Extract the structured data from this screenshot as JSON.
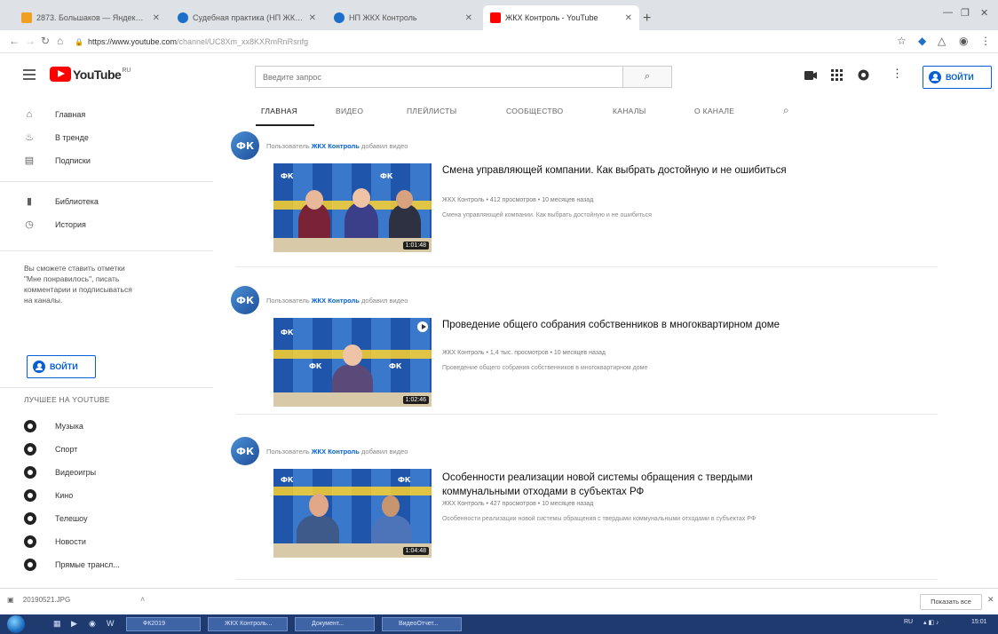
{
  "browser": {
    "tabs": [
      {
        "title": "2873. Большаков — Яндекс.Ди..",
        "favicon_color": "#f0a020",
        "active": false
      },
      {
        "title": "Судебная практика (НП ЖКХ ...",
        "favicon_color": "#1d6fc8",
        "active": false
      },
      {
        "title": "НП ЖКХ Контроль",
        "favicon_color": "#1d6fc8",
        "active": false
      },
      {
        "title": "ЖКХ Контроль - YouTube",
        "favicon_color": "#ff0000",
        "active": true
      }
    ],
    "new_tab_label": "+",
    "url_host": "https://www.youtube.com",
    "url_path": "/channel/UC8Xm_xx8KXRmRnRsnfg",
    "lock_icon": "lock-icon"
  },
  "masthead": {
    "logo_text": "YouTube",
    "logo_country": "RU",
    "search_placeholder": "Введите запрос",
    "signin_label": "ВОЙТИ"
  },
  "sidebar": {
    "nav": [
      {
        "label": "Главная",
        "icon": "home-icon"
      },
      {
        "label": "В тренде",
        "icon": "fire-icon"
      },
      {
        "label": "Подписки",
        "icon": "subscriptions-icon"
      }
    ],
    "library": [
      {
        "label": "Библиотека",
        "icon": "library-icon"
      },
      {
        "label": "История",
        "icon": "history-icon"
      }
    ],
    "signin_note": "Вы сможете ставить отметки \"Мне понравилось\", писать комментарии и подписываться на каналы.",
    "signin_label": "ВОЙТИ",
    "best_heading": "ЛУЧШЕЕ НА YOUTUBE",
    "best": [
      {
        "label": "Музыка",
        "icon": "music-icon"
      },
      {
        "label": "Спорт",
        "icon": "sport-icon"
      },
      {
        "label": "Видеоигры",
        "icon": "gaming-icon"
      },
      {
        "label": "Кино",
        "icon": "movies-icon"
      },
      {
        "label": "Телешоу",
        "icon": "tv-icon"
      },
      {
        "label": "Новости",
        "icon": "news-icon"
      },
      {
        "label": "Прямые трансл...",
        "icon": "live-icon"
      }
    ]
  },
  "channel_tabs": [
    "ГЛАВНАЯ",
    "ВИДЕО",
    "ПЛЕЙЛИСТЫ",
    "СООБЩЕСТВО",
    "КАНАЛЫ",
    "О КАНАЛЕ"
  ],
  "feed": [
    {
      "activity_prefix": "Пользователь",
      "channel": "ЖКХ Контроль",
      "activity_suffix": "добавил видео",
      "title": "Смена управляющей компании. Как выбрать достойную и не ошибиться",
      "meta": "ЖКХ Контроль • 412 просмотров • 10 месяцев назад",
      "description": "Смена управляющей компании. Как выбрать достойную и не ошибиться",
      "duration": "1:01:48"
    },
    {
      "activity_prefix": "Пользователь",
      "channel": "ЖКХ Контроль",
      "activity_suffix": "добавил видео",
      "title": "Проведение общего собрания собственников в многоквартирном доме",
      "meta": "ЖКХ Контроль • 1,4 тыс. просмотров • 10 месяцев назад",
      "description": "Проведение общего собрания собственников в многоквартирном доме",
      "duration": "1:02:46"
    },
    {
      "activity_prefix": "Пользователь",
      "channel": "ЖКХ Контроль",
      "activity_suffix": "добавил видео",
      "title": "Особенности реализации новой системы обращения с твердыми коммунальными отходами в субъектах РФ",
      "meta": "ЖКХ Контроль • 427 просмотров • 10 месяцев назад",
      "description": "Особенности реализации новой системы обращения с твердыми коммунальными отходами в субъектах РФ",
      "duration": "1:04:48"
    }
  ],
  "avatar_text": "ФК",
  "downloads": {
    "file": "20190521.JPG",
    "show_all": "Показать все"
  },
  "taskbar": {
    "buttons": [
      "ФК2019",
      "ЖКХ Контроль...",
      "Документ...",
      "ВидеоОтчет..."
    ],
    "tray_lang": "RU",
    "clock": "15:01"
  },
  "colors": {
    "accent": "#065fd4",
    "brand": "#ff0000"
  }
}
